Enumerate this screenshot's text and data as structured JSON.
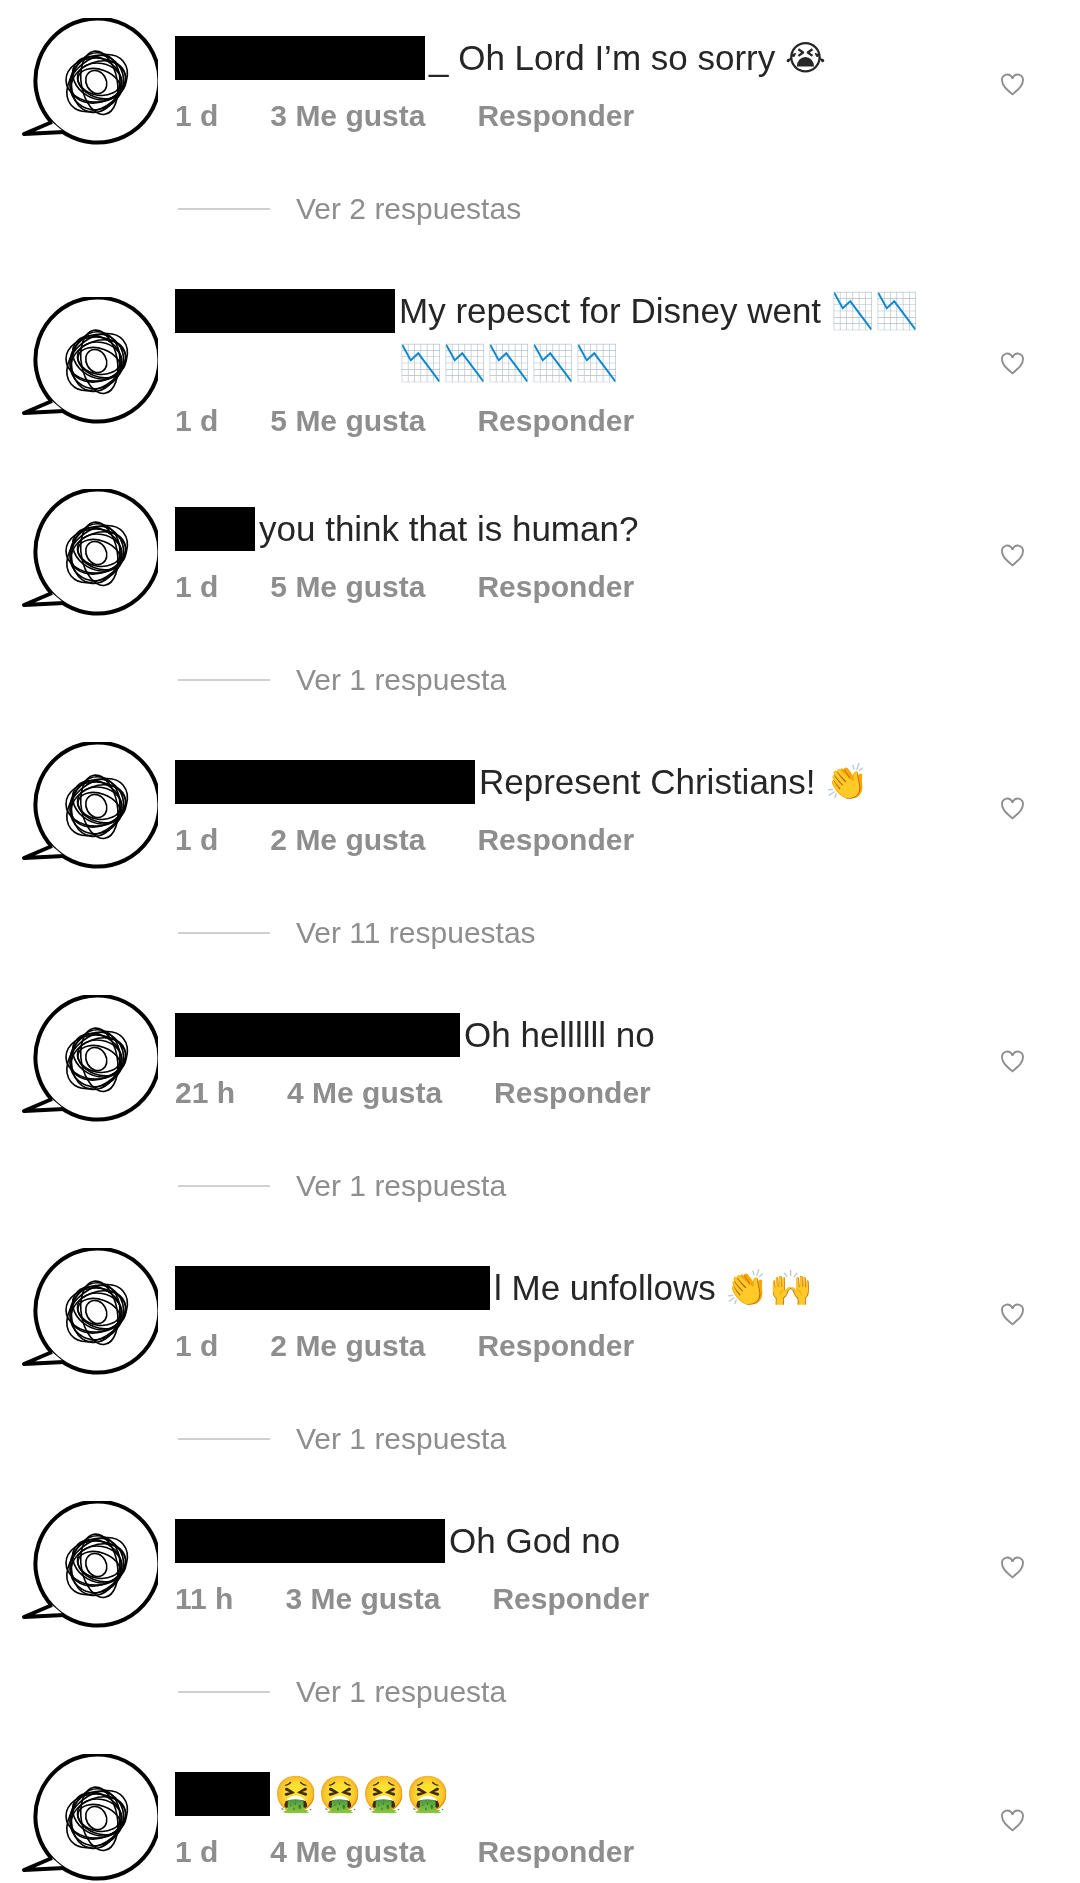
{
  "comments": [
    {
      "author_redacted": true,
      "text": "_ Oh Lord I’m so sorry 😭",
      "time": "1 d",
      "likes": "3 Me gusta",
      "reply": "Responder",
      "liked": false,
      "replies_link": "Ver 2 respuestas"
    },
    {
      "author_redacted": true,
      "text": "My repesct for Disney went 📉📉📉📉📉📉📉",
      "time": "1 d",
      "likes": "5 Me gusta",
      "reply": "Responder",
      "liked": false
    },
    {
      "author_redacted": true,
      "text": "you think that is human?",
      "time": "1 d",
      "likes": "5 Me gusta",
      "reply": "Responder",
      "liked": false,
      "replies_link": "Ver 1 respuesta"
    },
    {
      "author_redacted": true,
      "text": "Represent Christians! 👏",
      "time": "1 d",
      "likes": "2 Me gusta",
      "reply": "Responder",
      "liked": false,
      "replies_link": "Ver 11 respuestas"
    },
    {
      "author_redacted": true,
      "text": "Oh hellllll no",
      "time": "21 h",
      "likes": "4 Me gusta",
      "reply": "Responder",
      "liked": false,
      "replies_link": "Ver 1 respuesta"
    },
    {
      "author_redacted": true,
      "text": "l Me unfollows 👏🙌",
      "time": "1 d",
      "likes": "2 Me gusta",
      "reply": "Responder",
      "liked": false,
      "replies_link": "Ver 1 respuesta"
    },
    {
      "author_redacted": true,
      "text": "Oh God no",
      "time": "11 h",
      "likes": "3 Me gusta",
      "reply": "Responder",
      "liked": false,
      "replies_link": "Ver 1 respuesta"
    },
    {
      "author_redacted": true,
      "text": "🤮🤮🤮🤮",
      "time": "1 d",
      "likes": "4 Me gusta",
      "reply": "Responder",
      "liked": false
    }
  ]
}
